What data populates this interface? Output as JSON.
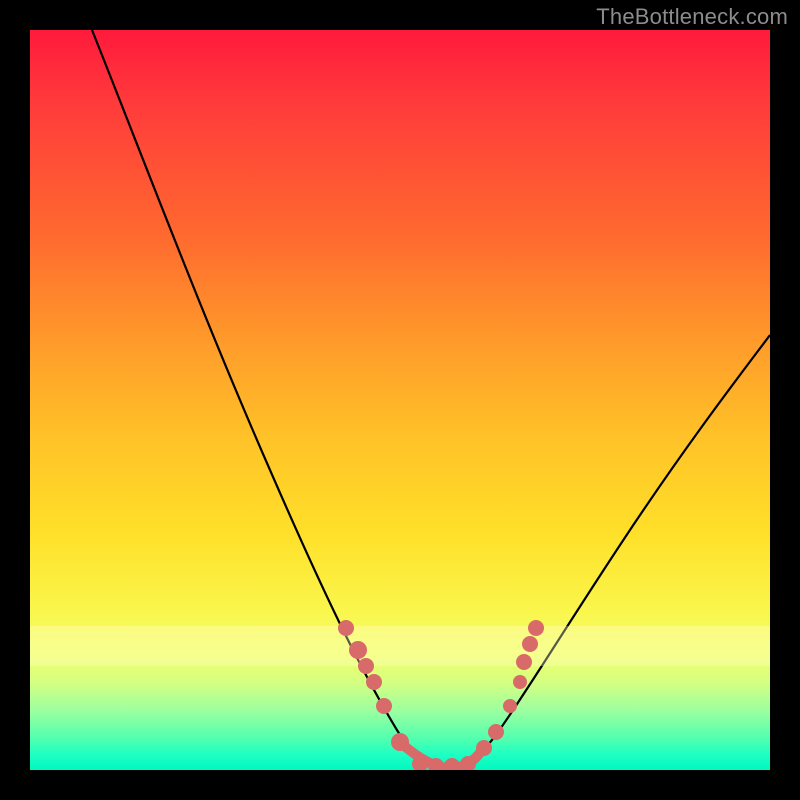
{
  "watermark": "TheBottleneck.com",
  "chart_data": {
    "type": "line",
    "title": "",
    "xlabel": "",
    "ylabel": "",
    "xlim": [
      0,
      100
    ],
    "ylim": [
      0,
      100
    ],
    "series": [
      {
        "name": "bottleneck-curve",
        "x": [
          0,
          5,
          10,
          15,
          20,
          25,
          30,
          35,
          40,
          45,
          50,
          52,
          54,
          56,
          58,
          60,
          63,
          66,
          70,
          75,
          80,
          85,
          90,
          95,
          100
        ],
        "values": [
          100,
          93,
          86,
          78,
          70,
          61,
          52,
          42,
          32,
          21,
          8,
          4,
          1,
          0,
          0,
          1,
          4,
          9,
          16,
          24,
          32,
          39,
          46,
          52,
          58
        ]
      }
    ],
    "highlight_points": {
      "name": "sweet-spot-dots",
      "color": "#e27070",
      "x": [
        42,
        44,
        45,
        47,
        50,
        53,
        56,
        59,
        61,
        63,
        64,
        65
      ],
      "values": [
        28,
        24,
        22,
        18,
        8,
        2,
        0,
        2,
        6,
        12,
        18,
        22
      ]
    },
    "background_gradient": {
      "top": "#ff1a3c",
      "mid": "#ffe029",
      "bottom": "#00f8c0"
    }
  }
}
